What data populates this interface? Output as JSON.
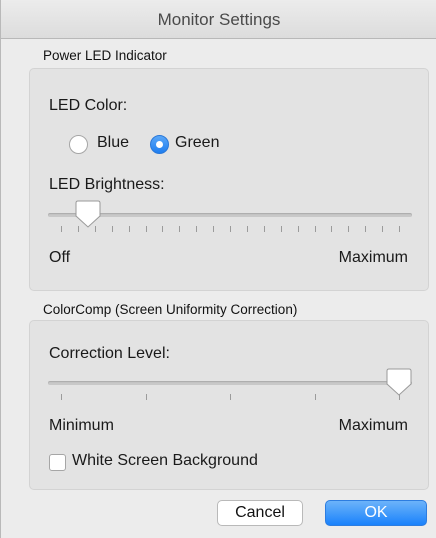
{
  "window": {
    "title": "Monitor Settings"
  },
  "power_led": {
    "section_title": "Power LED Indicator",
    "color_label": "LED Color:",
    "options": [
      {
        "label": "Blue",
        "selected": false
      },
      {
        "label": "Green",
        "selected": true
      }
    ],
    "brightness_label": "LED Brightness:",
    "brightness_min_label": "Off",
    "brightness_max_label": "Maximum",
    "brightness_value_fraction": 0.08,
    "brightness_tick_count": 21
  },
  "colorcomp": {
    "section_title": "ColorComp (Screen Uniformity Correction)",
    "level_label": "Correction Level:",
    "level_min_label": "Minimum",
    "level_max_label": "Maximum",
    "level_value_fraction": 1.0,
    "level_tick_count": 5,
    "white_bg_label": "White Screen Background",
    "white_bg_checked": false
  },
  "buttons": {
    "cancel_label": "Cancel",
    "ok_label": "OK"
  },
  "colors": {
    "accent": "#1f7ef0",
    "window_bg": "#ececec",
    "group_bg": "#e3e3e3"
  },
  "icons": {
    "radio_selected": "radio-selected-icon",
    "radio_unselected": "radio-unselected-icon",
    "slider_thumb": "slider-thumb-icon",
    "checkbox": "checkbox-icon"
  }
}
